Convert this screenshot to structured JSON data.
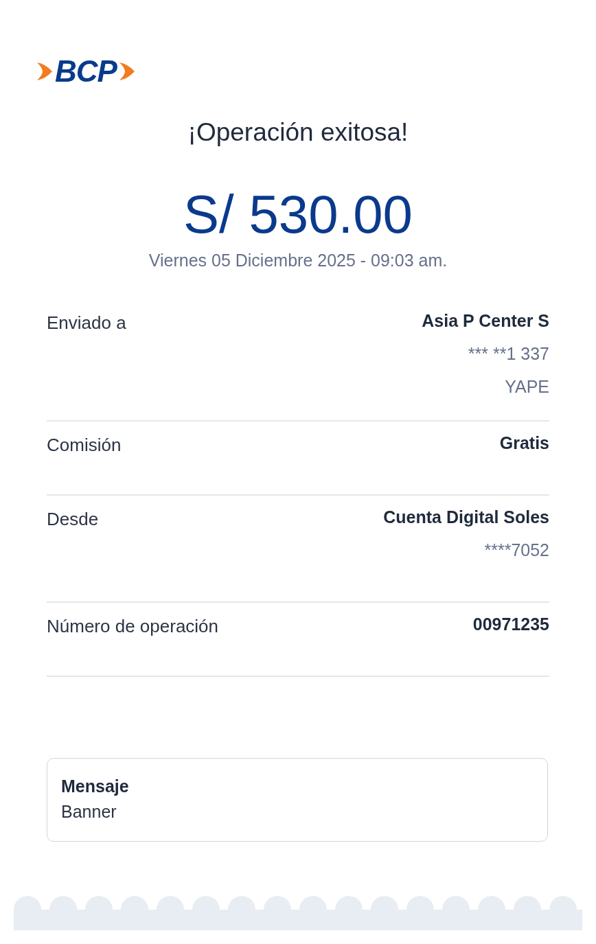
{
  "logo": {
    "text": "BCP"
  },
  "title": "¡Operación exitosa!",
  "amount": "S/ 530.00",
  "date": "Viernes 05 Diciembre 2025 - 09:03 am.",
  "details": [
    {
      "label": "Enviado a",
      "values": [
        {
          "text": "Asia P Center S",
          "kind": "bold"
        },
        {
          "text": "*** **1 337",
          "kind": "plain"
        },
        {
          "text": "YAPE",
          "kind": "plain"
        }
      ]
    },
    {
      "label": "Comisión",
      "values": [
        {
          "text": "Gratis",
          "kind": "bold"
        }
      ]
    },
    {
      "label": "Desde",
      "values": [
        {
          "text": "Cuenta Digital Soles",
          "kind": "bold"
        },
        {
          "text": "****7052",
          "kind": "plain"
        }
      ]
    },
    {
      "label": "Número de operación",
      "values": [
        {
          "text": "00971235",
          "kind": "bold"
        }
      ]
    }
  ],
  "message": {
    "title": "Mensaje",
    "text": "Banner"
  }
}
